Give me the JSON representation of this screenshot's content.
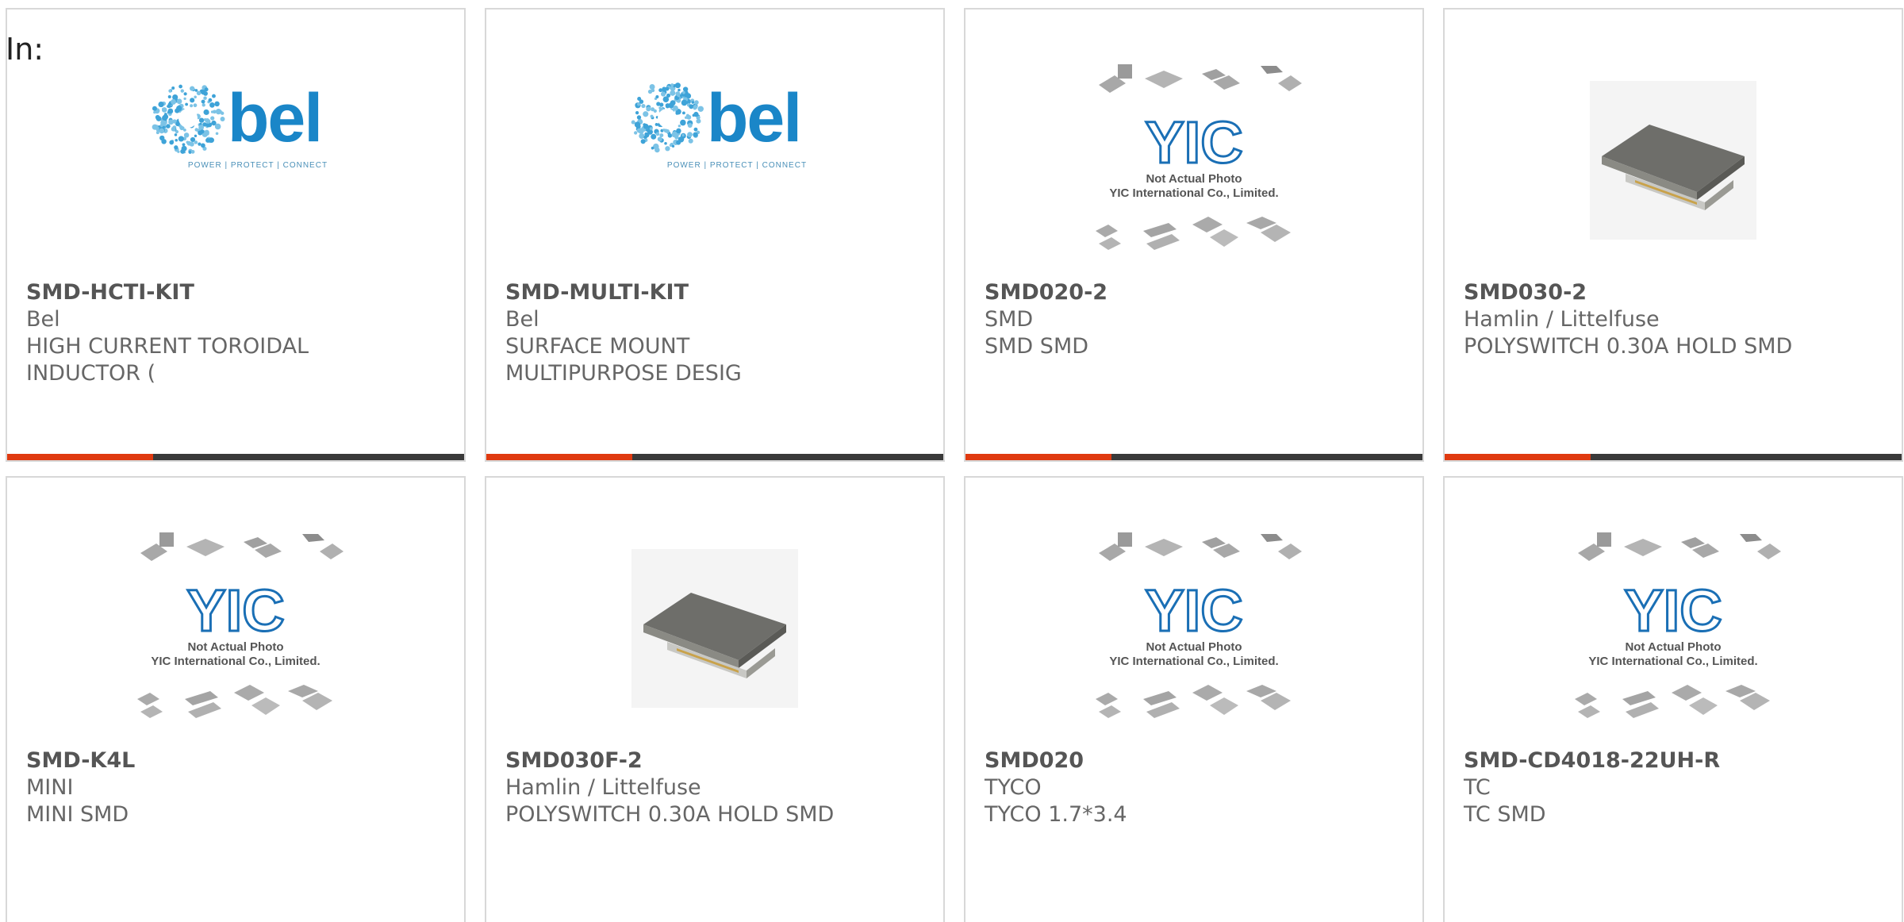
{
  "filter": {
    "label": "In:"
  },
  "products": [
    {
      "part_number": "SMD-HCTI-KIT",
      "brand": "Bel",
      "desc1": "HIGH CURRENT TOROIDAL",
      "desc2": "INDUCTOR (",
      "image_type": "bel-logo",
      "logo": {
        "text": "bel",
        "tagline": "POWER | PROTECT | CONNECT"
      }
    },
    {
      "part_number": "SMD-MULTI-KIT",
      "brand": "Bel",
      "desc1": "SURFACE MOUNT",
      "desc2": "MULTIPURPOSE DESIG",
      "image_type": "bel-logo",
      "logo": {
        "text": "bel",
        "tagline": "POWER | PROTECT | CONNECT"
      }
    },
    {
      "part_number": "SMD020-2",
      "brand": "SMD",
      "desc1": "SMD SMD",
      "desc2": "",
      "image_type": "yic-placeholder",
      "placeholder": {
        "line1": "Not Actual Photo",
        "line2": "YIC International Co., Limited."
      }
    },
    {
      "part_number": "SMD030-2",
      "brand": "Hamlin / Littelfuse",
      "desc1": "POLYSWITCH 0.30A HOLD SMD",
      "desc2": "",
      "image_type": "chip-photo"
    },
    {
      "part_number": "SMD-K4L",
      "brand": "MINI",
      "desc1": "MINI SMD",
      "desc2": "",
      "image_type": "yic-placeholder",
      "placeholder": {
        "line1": "Not Actual Photo",
        "line2": "YIC International Co., Limited."
      }
    },
    {
      "part_number": "SMD030F-2",
      "brand": "Hamlin / Littelfuse",
      "desc1": "POLYSWITCH 0.30A HOLD SMD",
      "desc2": "",
      "image_type": "chip-photo"
    },
    {
      "part_number": "SMD020",
      "brand": "TYCO",
      "desc1": "TYCO 1.7*3.4",
      "desc2": "",
      "image_type": "yic-placeholder",
      "placeholder": {
        "line1": "Not Actual Photo",
        "line2": "YIC International Co., Limited."
      }
    },
    {
      "part_number": "SMD-CD4018-22UH-R",
      "brand": "TC",
      "desc1": "TC SMD",
      "desc2": "",
      "image_type": "yic-placeholder",
      "placeholder": {
        "line1": "Not Actual Photo",
        "line2": "YIC International Co., Limited."
      }
    }
  ],
  "colors": {
    "accent": "#e03a10",
    "bar": "#3a3a3a",
    "bel_blue": "#1a86c8",
    "yic_blue": "#1a6fb5"
  }
}
